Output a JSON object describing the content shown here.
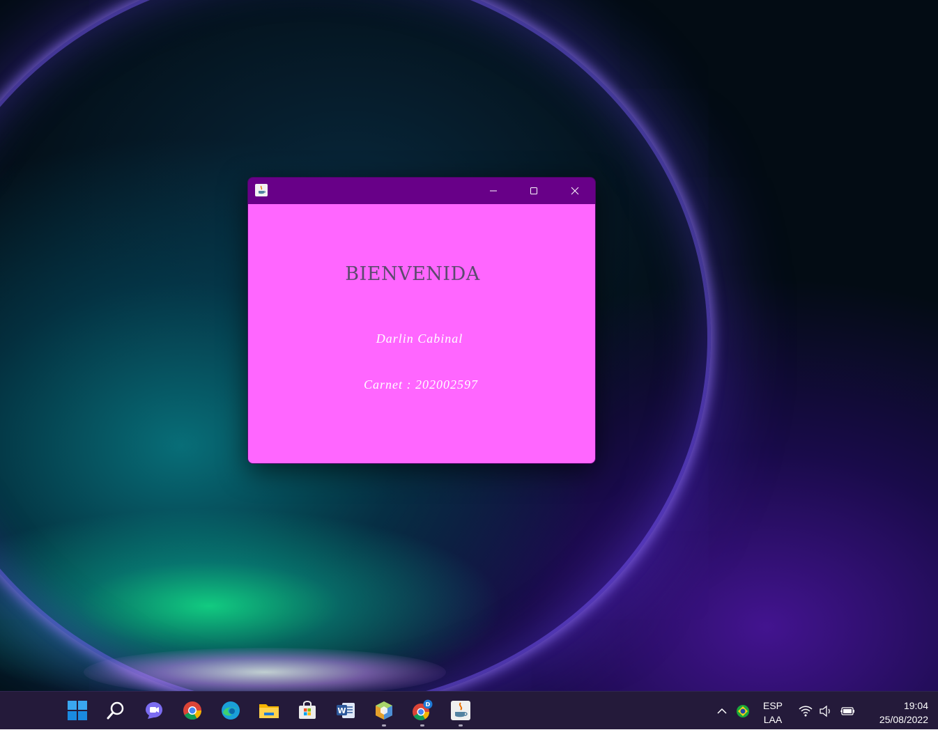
{
  "window": {
    "heading": "BIENVENIDA",
    "name": "Darlin Cabinal",
    "carnet": "Carnet : 202002597",
    "titlebar_color": "#680088",
    "content_color": "#ff66ff",
    "app_icon": "java-icon"
  },
  "taskbar": {
    "apps": [
      {
        "name": "start",
        "icon": "windows-start-icon"
      },
      {
        "name": "search",
        "icon": "search-icon"
      },
      {
        "name": "chat",
        "icon": "teams-chat-icon"
      },
      {
        "name": "chrome",
        "icon": "chrome-icon"
      },
      {
        "name": "edge",
        "icon": "edge-icon"
      },
      {
        "name": "file-explorer",
        "icon": "folder-icon"
      },
      {
        "name": "microsoft-store",
        "icon": "store-icon"
      },
      {
        "name": "word",
        "icon": "word-icon"
      },
      {
        "name": "netbeans",
        "icon": "netbeans-icon"
      },
      {
        "name": "chrome-profile",
        "icon": "chrome-profile-icon",
        "badge": "D"
      },
      {
        "name": "java-app",
        "icon": "java-icon"
      }
    ],
    "tray": {
      "language_top": "ESP",
      "language_bottom": "LAA",
      "time": "19:04",
      "date": "25/08/2022"
    }
  }
}
